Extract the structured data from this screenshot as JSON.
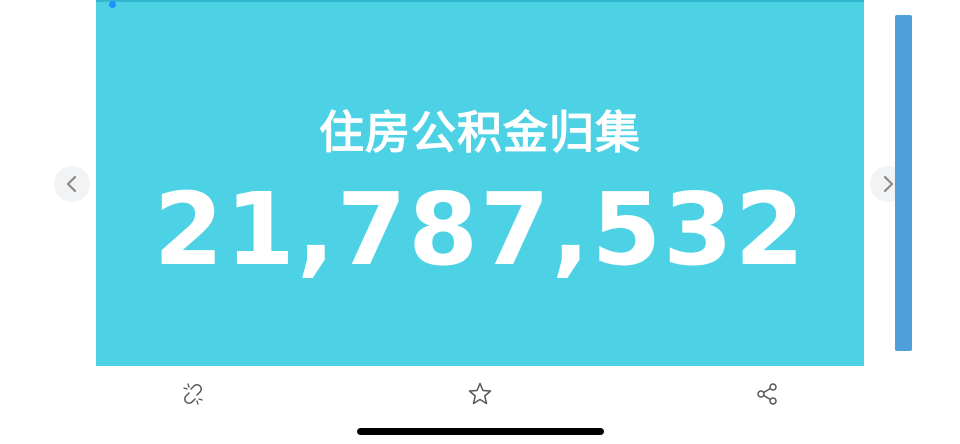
{
  "card": {
    "title": "住房公积金归集",
    "value": "21,787,532"
  },
  "colors": {
    "card_background": "#4dd2e5",
    "side_bar": "#4f9fdb",
    "icon_stroke": "#555555",
    "arrow_stroke": "#8a8a8a"
  },
  "icons": {
    "prev": "chevron-left-icon",
    "next": "chevron-right-icon",
    "link": "unlink-icon",
    "favorite": "star-icon",
    "share": "share-icon"
  }
}
